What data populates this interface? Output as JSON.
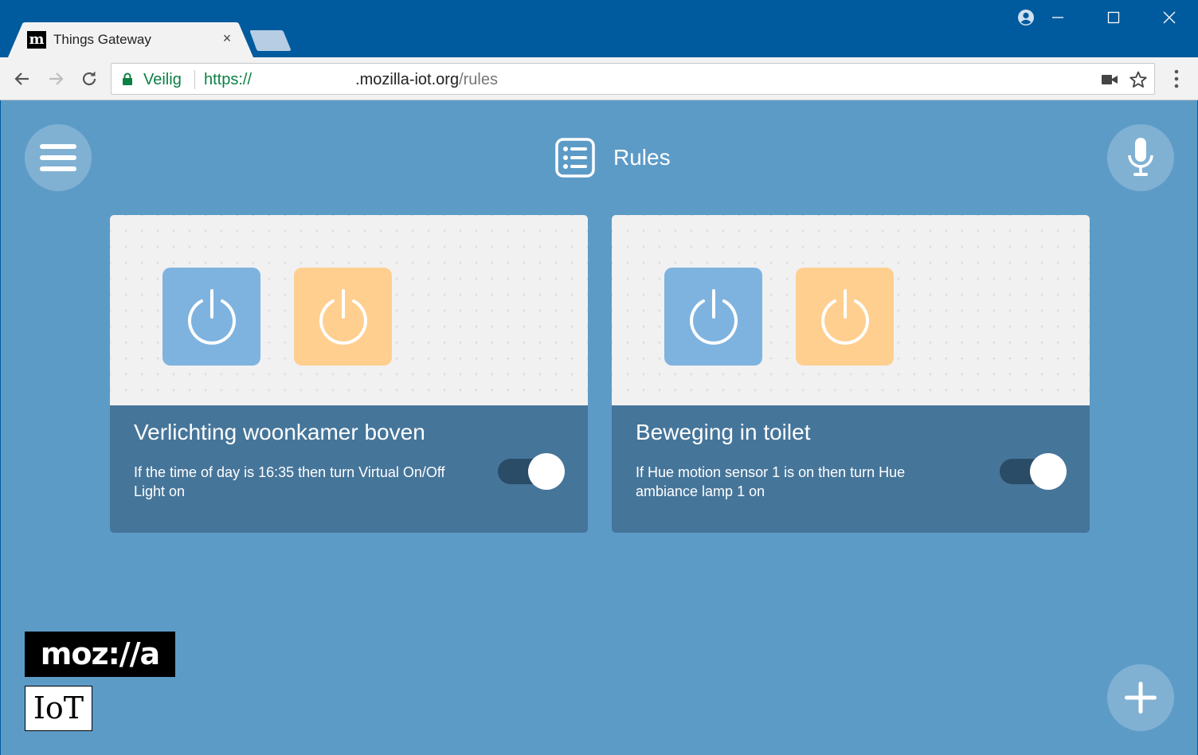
{
  "browser": {
    "tab": {
      "favicon_letter": "m",
      "title": "Things Gateway",
      "close_glyph": "×"
    },
    "address_bar": {
      "secure_label": "Veilig",
      "url_scheme": "https://",
      "url_host": ".mozilla-iot.org",
      "url_path": "/rules"
    },
    "icons": [
      "back-arrow-icon",
      "forward-arrow-icon",
      "reload-icon",
      "lock-icon",
      "camera-icon",
      "star-icon",
      "kebab-menu-icon",
      "profile-icon",
      "minimize-icon",
      "maximize-icon",
      "close-icon"
    ],
    "colors": {
      "titlebar": "#005a9e",
      "secure_green": "#0b8043"
    }
  },
  "app": {
    "title": "Rules",
    "rules": [
      {
        "name": "Verlichting woonkamer boven",
        "description": "If the time of day is 16:35 then turn Virtual On/Off Light on",
        "enabled": true
      },
      {
        "name": "Beweging in toilet",
        "description": "If Hue motion sensor 1 is on then turn Hue ambiance lamp 1 on",
        "enabled": true
      }
    ],
    "logo": {
      "line1": "moz://a",
      "line2": "IoT"
    },
    "colors": {
      "background": "#5d9bc7",
      "card_info": "#46759a",
      "trigger_tile": "#7eb3e0",
      "effect_tile": "#ffcf90",
      "toggle_track": "#2a4c66"
    }
  }
}
